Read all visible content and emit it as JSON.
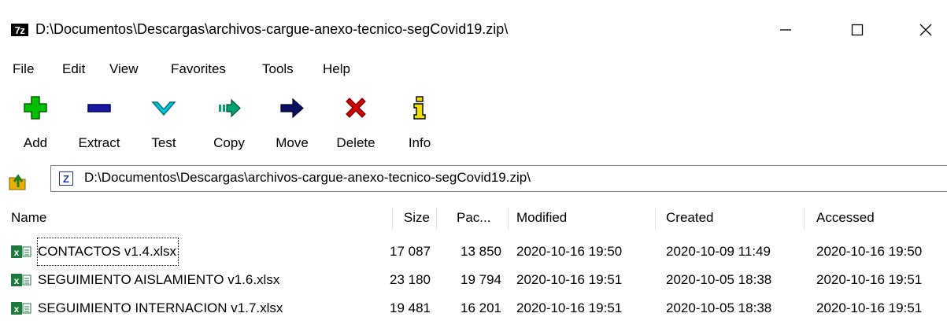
{
  "titlebar": {
    "app_icon_text": "7z",
    "title": "D:\\Documentos\\Descargas\\archivos-cargue-anexo-tecnico-segCovid19.zip\\",
    "minimize": "—",
    "maximize": "☐",
    "close": "✕"
  },
  "menu": [
    "File",
    "Edit",
    "View",
    "Favorites",
    "Tools",
    "Help"
  ],
  "toolbar": [
    {
      "label": "Add",
      "icon": "add-icon"
    },
    {
      "label": "Extract",
      "icon": "extract-icon"
    },
    {
      "label": "Test",
      "icon": "test-icon"
    },
    {
      "label": "Copy",
      "icon": "copy-icon"
    },
    {
      "label": "Move",
      "icon": "move-icon"
    },
    {
      "label": "Delete",
      "icon": "delete-icon"
    },
    {
      "label": "Info",
      "icon": "info-icon"
    }
  ],
  "address": {
    "path": "D:\\Documentos\\Descargas\\archivos-cargue-anexo-tecnico-segCovid19.zip\\"
  },
  "columns": [
    "Name",
    "Size",
    "Pac...",
    "Modified",
    "Created",
    "Accessed"
  ],
  "files": [
    {
      "name": "CONTACTOS v1.4.xlsx",
      "size": "17 087",
      "packed": "13 850",
      "modified": "2020-10-16 19:50",
      "created": "2020-10-09 11:49",
      "accessed": "2020-10-16 19:50"
    },
    {
      "name": "SEGUIMIENTO AISLAMIENTO v1.6.xlsx",
      "size": "23 180",
      "packed": "19 794",
      "modified": "2020-10-16 19:51",
      "created": "2020-10-05 18:38",
      "accessed": "2020-10-16 19:51"
    },
    {
      "name": "SEGUIMIENTO INTERNACION v1.7.xlsx",
      "size": "19 481",
      "packed": "16 201",
      "modified": "2020-10-16 19:51",
      "created": "2020-10-05 18:38",
      "accessed": "2020-10-16 19:51"
    }
  ],
  "colors": {
    "excel_green": "#1d7a3e",
    "add_green": "#00c000",
    "extract_blue": "#1a1aa0",
    "test_cyan": "#00c8d8",
    "copy_green": "#00a070",
    "move_navy": "#0a1060",
    "delete_red": "#d00000",
    "info_yellow": "#f0e000"
  }
}
